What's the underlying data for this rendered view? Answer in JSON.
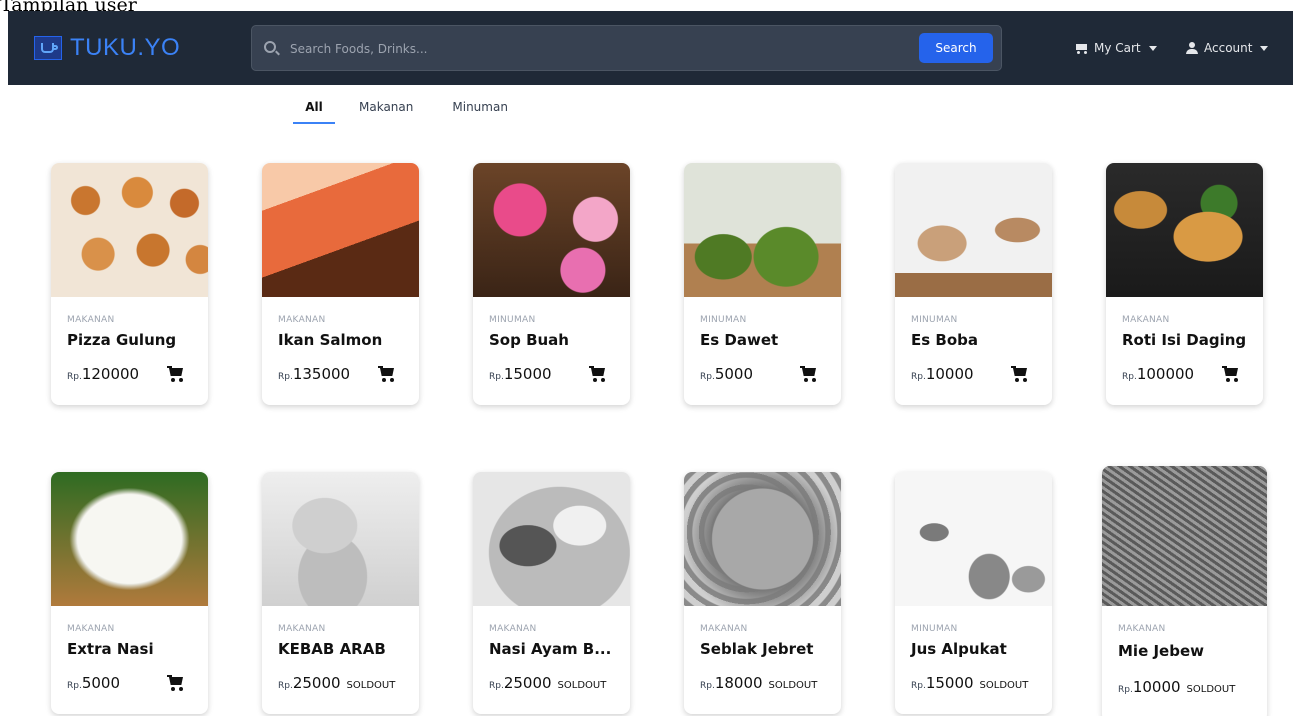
{
  "caption": "Tampilan user",
  "header": {
    "logo": "TUKU.YO",
    "search_placeholder": "Search Foods, Drinks...",
    "search_button": "Search",
    "cart_label": "My Cart",
    "account_label": "Account"
  },
  "tabs": [
    {
      "label": "All",
      "active": true
    },
    {
      "label": "Makanan",
      "active": false
    },
    {
      "label": "Minuman",
      "active": false
    }
  ],
  "currency_label": "Rp.",
  "products": [
    {
      "category": "MAKANAN",
      "name": "Pizza Gulung",
      "price": "120000",
      "status": "",
      "icon": "cart-icon"
    },
    {
      "category": "MAKANAN",
      "name": "Ikan Salmon",
      "price": "135000",
      "status": "",
      "icon": "cart-icon"
    },
    {
      "category": "MINUMAN",
      "name": "Sop Buah",
      "price": "15000",
      "status": "",
      "icon": "cart-icon"
    },
    {
      "category": "MINUMAN",
      "name": "Es Dawet",
      "price": "5000",
      "status": "",
      "icon": "cart-icon"
    },
    {
      "category": "MINUMAN",
      "name": "Es Boba",
      "price": "10000",
      "status": "",
      "icon": "cart-icon"
    },
    {
      "category": "MAKANAN",
      "name": "Roti Isi Daging",
      "price": "100000",
      "status": "",
      "icon": "cart-icon"
    },
    {
      "category": "MAKANAN",
      "name": "Extra Nasi",
      "price": "5000",
      "status": "",
      "icon": "cart-icon"
    },
    {
      "category": "MAKANAN",
      "name": "KEBAB ARAB",
      "price": "25000",
      "status": "SOLDOUT"
    },
    {
      "category": "MAKANAN",
      "name": "Nasi Ayam B...",
      "price": "25000",
      "status": "SOLDOUT"
    },
    {
      "category": "MAKANAN",
      "name": "Seblak Jebret",
      "price": "18000",
      "status": "SOLDOUT"
    },
    {
      "category": "MINUMAN",
      "name": "Jus Alpukat",
      "price": "15000",
      "status": "SOLDOUT"
    },
    {
      "category": "MAKANAN",
      "name": "Mie Jebew",
      "price": "10000",
      "status": "SOLDOUT"
    }
  ],
  "colors": {
    "navbar": "#1f2937",
    "accent": "#2563eb",
    "logo": "#3b82f6"
  }
}
